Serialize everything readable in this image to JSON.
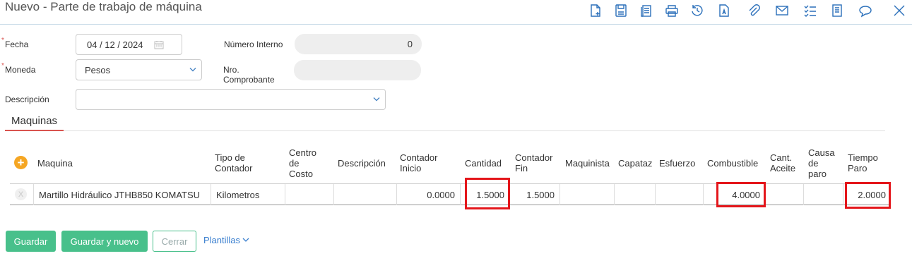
{
  "window": {
    "title": "Nuevo - Parte de trabajo de máquina"
  },
  "toolbar": {
    "icons": [
      "new-document-icon",
      "save-icon",
      "copy-icon",
      "print-icon",
      "history-icon",
      "text-document-icon",
      "attachment-icon",
      "email-icon",
      "checklist-icon",
      "book-icon",
      "comment-icon",
      "close-icon"
    ]
  },
  "form": {
    "required_mark": "*",
    "fecha": {
      "label": "Fecha",
      "value": "04 / 12 / 2024"
    },
    "numero_interno": {
      "label": "Número Interno",
      "value": "0"
    },
    "moneda": {
      "label": "Moneda",
      "value": "Pesos"
    },
    "nro_comprobante": {
      "label_line1": "Nro.",
      "label_line2": "Comprobante",
      "value": ""
    },
    "descripcion": {
      "label": "Descripción",
      "value": ""
    }
  },
  "tabs": {
    "maquinas": "Maquinas"
  },
  "table": {
    "headers": {
      "maquina": "Maquina",
      "tipo_contador": [
        "Tipo de",
        "Contador"
      ],
      "centro_costo": [
        "Centro",
        "de",
        "Costo"
      ],
      "descripcion": "Descripción",
      "contador_inicio": [
        "Contador",
        "Inicio"
      ],
      "cantidad": "Cantidad",
      "contador_fin": [
        "Contador",
        "Fin"
      ],
      "maquinista": "Maquinista",
      "capataz": "Capataz",
      "esfuerzo": "Esfuerzo",
      "combustible": "Combustible",
      "cant_aceite": [
        "Cant.",
        "Aceite"
      ],
      "causa_paro": [
        "Causa",
        "de",
        "paro"
      ],
      "tiempo_paro": [
        "Tiempo",
        "Paro"
      ]
    },
    "rows": [
      {
        "maquina": "Martillo Hidráulico JTHB850 KOMATSU",
        "tipo_contador": "Kilometros",
        "centro_costo": "",
        "descripcion": "",
        "contador_inicio": "0.0000",
        "cantidad": "1.5000",
        "contador_fin": "1.5000",
        "maquinista": "",
        "capataz": "",
        "esfuerzo": "",
        "combustible": "4.0000",
        "cant_aceite": "",
        "causa_paro": "",
        "tiempo_paro": "2.0000"
      }
    ],
    "add_symbol": "+",
    "delete_symbol": "X"
  },
  "footer": {
    "guardar": "Guardar",
    "guardar_nuevo": "Guardar y nuevo",
    "cerrar": "Cerrar",
    "plantillas": "Plantillas"
  },
  "colors": {
    "accent_green": "#48c08b",
    "highlight_red": "#e4161b",
    "tab_underline": "#d9534f",
    "icon_blue": "#2a6fba"
  }
}
